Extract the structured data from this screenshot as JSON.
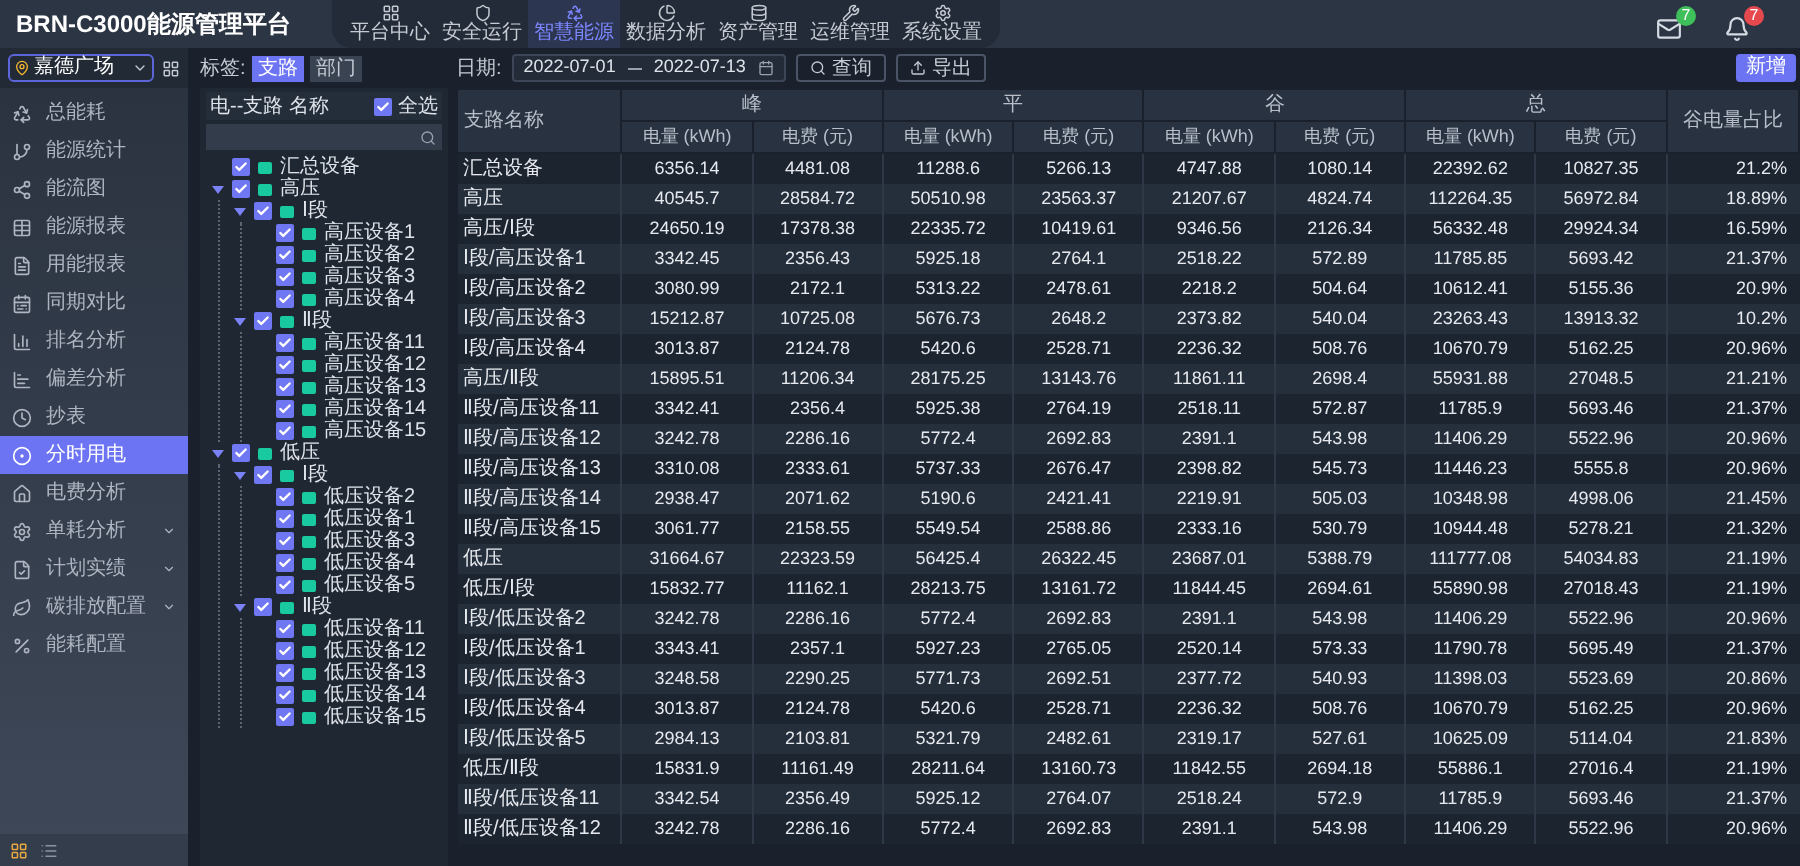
{
  "header": {
    "title": "BRN-C3000能源管理平台",
    "nav": [
      {
        "label": "平台中心",
        "selected": false
      },
      {
        "label": "安全运行",
        "selected": false
      },
      {
        "label": "智慧能源",
        "selected": true
      },
      {
        "label": "数据分析",
        "selected": false
      },
      {
        "label": "资产管理",
        "selected": false
      },
      {
        "label": "运维管理",
        "selected": false
      },
      {
        "label": "系统设置",
        "selected": false
      }
    ],
    "notifications": [
      {
        "kind": "mail",
        "count": "7",
        "color": "#3fbf5a"
      },
      {
        "kind": "bell",
        "count": "7",
        "color": "#e5484d"
      }
    ]
  },
  "location_select": {
    "value": "嘉德广场"
  },
  "sidebar": {
    "items": [
      {
        "label": "总能耗",
        "selected": false,
        "expandable": false
      },
      {
        "label": "能源统计",
        "selected": false,
        "expandable": false
      },
      {
        "label": "能流图",
        "selected": false,
        "expandable": false
      },
      {
        "label": "能源报表",
        "selected": false,
        "expandable": false
      },
      {
        "label": "用能报表",
        "selected": false,
        "expandable": false
      },
      {
        "label": "同期对比",
        "selected": false,
        "expandable": false
      },
      {
        "label": "排名分析",
        "selected": false,
        "expandable": false
      },
      {
        "label": "偏差分析",
        "selected": false,
        "expandable": false
      },
      {
        "label": "抄表",
        "selected": false,
        "expandable": false
      },
      {
        "label": "分时用电",
        "selected": true,
        "expandable": false
      },
      {
        "label": "电费分析",
        "selected": false,
        "expandable": false
      },
      {
        "label": "单耗分析",
        "selected": false,
        "expandable": true
      },
      {
        "label": "计划实绩",
        "selected": false,
        "expandable": true
      },
      {
        "label": "碳排放配置",
        "selected": false,
        "expandable": true
      },
      {
        "label": "能耗配置",
        "selected": false,
        "expandable": false
      }
    ]
  },
  "filter": {
    "label": "标签:",
    "tabs": [
      {
        "label": "支路",
        "selected": true
      },
      {
        "label": "部门",
        "selected": false
      }
    ]
  },
  "tree": {
    "title": "电--支路 名称",
    "select_all": {
      "label": "全选",
      "checked": true
    },
    "nodes": [
      {
        "label": "汇总设备",
        "checked": true
      },
      {
        "label": "高压",
        "checked": true,
        "expanded": true,
        "children": [
          {
            "label": "Ⅰ段",
            "checked": true,
            "expanded": true,
            "children": [
              {
                "label": "高压设备1",
                "checked": true
              },
              {
                "label": "高压设备2",
                "checked": true
              },
              {
                "label": "高压设备3",
                "checked": true
              },
              {
                "label": "高压设备4",
                "checked": true
              }
            ]
          },
          {
            "label": "Ⅱ段",
            "checked": true,
            "expanded": true,
            "children": [
              {
                "label": "高压设备11",
                "checked": true
              },
              {
                "label": "高压设备12",
                "checked": true
              },
              {
                "label": "高压设备13",
                "checked": true
              },
              {
                "label": "高压设备14",
                "checked": true
              },
              {
                "label": "高压设备15",
                "checked": true
              }
            ]
          }
        ]
      },
      {
        "label": "低压",
        "checked": true,
        "expanded": true,
        "children": [
          {
            "label": "Ⅰ段",
            "checked": true,
            "expanded": true,
            "children": [
              {
                "label": "低压设备2",
                "checked": true
              },
              {
                "label": "低压设备1",
                "checked": true
              },
              {
                "label": "低压设备3",
                "checked": true
              },
              {
                "label": "低压设备4",
                "checked": true
              },
              {
                "label": "低压设备5",
                "checked": true
              }
            ]
          },
          {
            "label": "Ⅱ段",
            "checked": true,
            "expanded": true,
            "children": [
              {
                "label": "低压设备11",
                "checked": true
              },
              {
                "label": "低压设备12",
                "checked": true
              },
              {
                "label": "低压设备13",
                "checked": true
              },
              {
                "label": "低压设备14",
                "checked": true
              },
              {
                "label": "低压设备15",
                "checked": true
              }
            ]
          }
        ]
      }
    ]
  },
  "toolbar": {
    "date_label": "日期:",
    "start": "2022-07-01",
    "end": "2022-07-13",
    "buttons": [
      {
        "kind": "search",
        "label": "查询"
      },
      {
        "kind": "export",
        "label": "导出"
      }
    ],
    "add_button": "新增"
  },
  "table": {
    "name_header": "支路名称",
    "ratio_header": "谷电量占比",
    "groups": [
      {
        "label": "峰",
        "columns": [
          "电量 (kWh)",
          "电费 (元)"
        ]
      },
      {
        "label": "平",
        "columns": [
          "电量 (kWh)",
          "电费 (元)"
        ]
      },
      {
        "label": "谷",
        "columns": [
          "电量 (kWh)",
          "电费 (元)"
        ]
      },
      {
        "label": "总",
        "columns": [
          "电量 (kWh)",
          "电费 (元)"
        ]
      }
    ],
    "rows": [
      {
        "name": "汇总设备",
        "values": [
          "6356.14",
          "4481.08",
          "11288.6",
          "5266.13",
          "4747.88",
          "1080.14",
          "22392.62",
          "10827.35",
          "21.2%"
        ]
      },
      {
        "name": "高压",
        "values": [
          "40545.7",
          "28584.72",
          "50510.98",
          "23563.37",
          "21207.67",
          "4824.74",
          "112264.35",
          "56972.84",
          "18.89%"
        ]
      },
      {
        "name": "高压/Ⅰ段",
        "values": [
          "24650.19",
          "17378.38",
          "22335.72",
          "10419.61",
          "9346.56",
          "2126.34",
          "56332.48",
          "29924.34",
          "16.59%"
        ]
      },
      {
        "name": "Ⅰ段/高压设备1",
        "values": [
          "3342.45",
          "2356.43",
          "5925.18",
          "2764.1",
          "2518.22",
          "572.89",
          "11785.85",
          "5693.42",
          "21.37%"
        ]
      },
      {
        "name": "Ⅰ段/高压设备2",
        "values": [
          "3080.99",
          "2172.1",
          "5313.22",
          "2478.61",
          "2218.2",
          "504.64",
          "10612.41",
          "5155.36",
          "20.9%"
        ]
      },
      {
        "name": "Ⅰ段/高压设备3",
        "values": [
          "15212.87",
          "10725.08",
          "5676.73",
          "2648.2",
          "2373.82",
          "540.04",
          "23263.43",
          "13913.32",
          "10.2%"
        ]
      },
      {
        "name": "Ⅰ段/高压设备4",
        "values": [
          "3013.87",
          "2124.78",
          "5420.6",
          "2528.71",
          "2236.32",
          "508.76",
          "10670.79",
          "5162.25",
          "20.96%"
        ]
      },
      {
        "name": "高压/Ⅱ段",
        "values": [
          "15895.51",
          "11206.34",
          "28175.25",
          "13143.76",
          "11861.11",
          "2698.4",
          "55931.88",
          "27048.5",
          "21.21%"
        ]
      },
      {
        "name": "Ⅱ段/高压设备11",
        "values": [
          "3342.41",
          "2356.4",
          "5925.38",
          "2764.19",
          "2518.11",
          "572.87",
          "11785.9",
          "5693.46",
          "21.37%"
        ]
      },
      {
        "name": "Ⅱ段/高压设备12",
        "values": [
          "3242.78",
          "2286.16",
          "5772.4",
          "2692.83",
          "2391.1",
          "543.98",
          "11406.29",
          "5522.96",
          "20.96%"
        ]
      },
      {
        "name": "Ⅱ段/高压设备13",
        "values": [
          "3310.08",
          "2333.61",
          "5737.33",
          "2676.47",
          "2398.82",
          "545.73",
          "11446.23",
          "5555.8",
          "20.96%"
        ]
      },
      {
        "name": "Ⅱ段/高压设备14",
        "values": [
          "2938.47",
          "2071.62",
          "5190.6",
          "2421.41",
          "2219.91",
          "505.03",
          "10348.98",
          "4998.06",
          "21.45%"
        ]
      },
      {
        "name": "Ⅱ段/高压设备15",
        "values": [
          "3061.77",
          "2158.55",
          "5549.54",
          "2588.86",
          "2333.16",
          "530.79",
          "10944.48",
          "5278.21",
          "21.32%"
        ]
      },
      {
        "name": "低压",
        "values": [
          "31664.67",
          "22323.59",
          "56425.4",
          "26322.45",
          "23687.01",
          "5388.79",
          "111777.08",
          "54034.83",
          "21.19%"
        ]
      },
      {
        "name": "低压/Ⅰ段",
        "values": [
          "15832.77",
          "11162.1",
          "28213.75",
          "13161.72",
          "11844.45",
          "2694.61",
          "55890.98",
          "27018.43",
          "21.19%"
        ]
      },
      {
        "name": "Ⅰ段/低压设备2",
        "values": [
          "3242.78",
          "2286.16",
          "5772.4",
          "2692.83",
          "2391.1",
          "543.98",
          "11406.29",
          "5522.96",
          "20.96%"
        ]
      },
      {
        "name": "Ⅰ段/低压设备1",
        "values": [
          "3343.41",
          "2357.1",
          "5927.23",
          "2765.05",
          "2520.14",
          "573.33",
          "11790.78",
          "5695.49",
          "21.37%"
        ]
      },
      {
        "name": "Ⅰ段/低压设备3",
        "values": [
          "3248.58",
          "2290.25",
          "5771.73",
          "2692.51",
          "2377.72",
          "540.93",
          "11398.03",
          "5523.69",
          "20.86%"
        ]
      },
      {
        "name": "Ⅰ段/低压设备4",
        "values": [
          "3013.87",
          "2124.78",
          "5420.6",
          "2528.71",
          "2236.32",
          "508.76",
          "10670.79",
          "5162.25",
          "20.96%"
        ]
      },
      {
        "name": "Ⅰ段/低压设备5",
        "values": [
          "2984.13",
          "2103.81",
          "5321.79",
          "2482.61",
          "2319.17",
          "527.61",
          "10625.09",
          "5114.04",
          "21.83%"
        ]
      },
      {
        "name": "低压/Ⅱ段",
        "values": [
          "15831.9",
          "11161.49",
          "28211.64",
          "13160.73",
          "11842.55",
          "2694.18",
          "55886.1",
          "27016.4",
          "21.19%"
        ]
      },
      {
        "name": "Ⅱ段/低压设备11",
        "values": [
          "3342.54",
          "2356.49",
          "5925.12",
          "2764.07",
          "2518.24",
          "572.9",
          "11785.9",
          "5693.46",
          "21.37%"
        ]
      },
      {
        "name": "Ⅱ段/低压设备12",
        "values": [
          "3242.78",
          "2286.16",
          "5772.4",
          "2692.83",
          "2391.1",
          "543.98",
          "11406.29",
          "5522.96",
          "20.96%"
        ]
      }
    ]
  }
}
